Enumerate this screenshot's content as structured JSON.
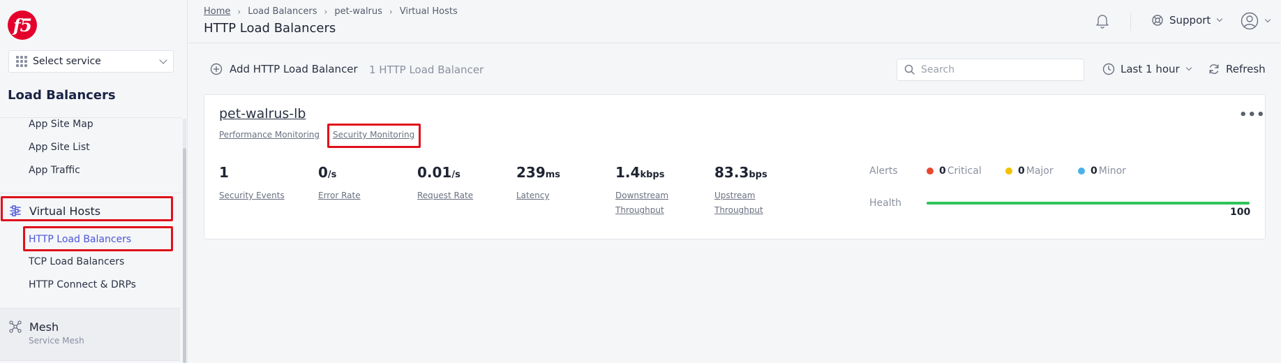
{
  "brand": {
    "logo_text": "f5",
    "accent_color": "#e4002b"
  },
  "sidebar": {
    "select_service": "Select service",
    "section_title": "Load Balancers",
    "sub_items_top": [
      "App Site Map",
      "App Site List",
      "App Traffic"
    ],
    "virtual_hosts": {
      "label": "Virtual Hosts",
      "icon": "virtual-hosts-icon",
      "children": [
        "HTTP Load Balancers",
        "TCP Load Balancers",
        "HTTP Connect & DRPs"
      ]
    },
    "mesh": {
      "label": "Mesh",
      "subtitle": "Service Mesh",
      "icon": "mesh-icon"
    }
  },
  "header": {
    "breadcrumb": [
      "Home",
      "Load Balancers",
      "pet-walrus",
      "Virtual Hosts"
    ],
    "title": "HTTP Load Balancers",
    "support_label": "Support"
  },
  "toolbar": {
    "add_label": "Add HTTP Load Balancer",
    "count_label": "1 HTTP Load Balancer",
    "search_placeholder": "Search",
    "time_range": "Last 1 hour",
    "refresh_label": "Refresh"
  },
  "card": {
    "name": "pet-walrus-lb",
    "tabs": [
      "Performance Monitoring",
      "Security Monitoring"
    ],
    "metrics": [
      {
        "value": "1",
        "unit": "",
        "label": "Security Events"
      },
      {
        "value": "0",
        "unit": "/s",
        "label": "Error Rate"
      },
      {
        "value": "0.01",
        "unit": "/s",
        "label": "Request Rate"
      },
      {
        "value": "239",
        "unit": "ms",
        "label": "Latency"
      },
      {
        "value": "1.4",
        "unit": "kbps",
        "label": "Downstream Throughput"
      },
      {
        "value": "83.3",
        "unit": "bps",
        "label": "Upstream Throughput"
      }
    ],
    "alerts": {
      "label": "Alerts",
      "items": [
        {
          "count": "0",
          "label": "Critical",
          "color": "#e8492e"
        },
        {
          "count": "0",
          "label": "Major",
          "color": "#f2c200"
        },
        {
          "count": "0",
          "label": "Minor",
          "color": "#4ab2ea"
        }
      ]
    },
    "health": {
      "label": "Health",
      "value": "100",
      "fraction": 1.0,
      "color": "#2fc35a"
    }
  },
  "highlight_color": "#e0101a"
}
